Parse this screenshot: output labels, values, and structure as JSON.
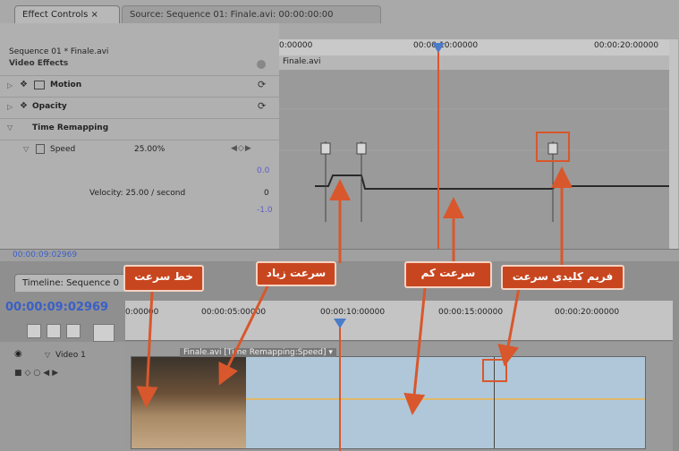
{
  "effect_controls": {
    "tab_effect": "Effect Controls ×",
    "tab_source": "Source: Sequence 01: Finale.avi: 00:00:00:00",
    "sequence_label": "Sequence 01 * Finale.avi",
    "section_label": "Video Effects",
    "clip_label": "Finale.avi",
    "ruler": [
      "0:00000",
      "00:00:10:00000",
      "00:00:20:00000"
    ],
    "effects": {
      "motion": "Motion",
      "opacity": "Opacity",
      "time_remapping": "Time Remapping",
      "speed_label": "Speed",
      "speed_value": "25.00%",
      "velocity_label": "Velocity: 25.00 / second",
      "graph_top": "0.0",
      "graph_mid": "0",
      "graph_bottom": "-1.0"
    },
    "current_time": "00:00:09:02969"
  },
  "timeline": {
    "tab_label": "Timeline: Sequence 0",
    "timecode": "00:00:09:02969",
    "ruler": [
      "0:00000",
      "00:00:05:00000",
      "00:00:10:00000",
      "00:00:15:00000",
      "00:00:20:00000"
    ],
    "track_label": "Video 1",
    "clip_label": "Finale.avi [Time Remapping:Speed] ▾"
  },
  "callouts": {
    "speed_line": "خط سرعت",
    "speed_up": "سرعت زیاد",
    "speed_down": "سرعت کم",
    "speed_keyframe": "فریم کلیدی سرعت"
  },
  "colors": {
    "accent": "#c8461f",
    "playhead": "#4a7cc9",
    "timecode_blue": "#3a5fc8"
  }
}
